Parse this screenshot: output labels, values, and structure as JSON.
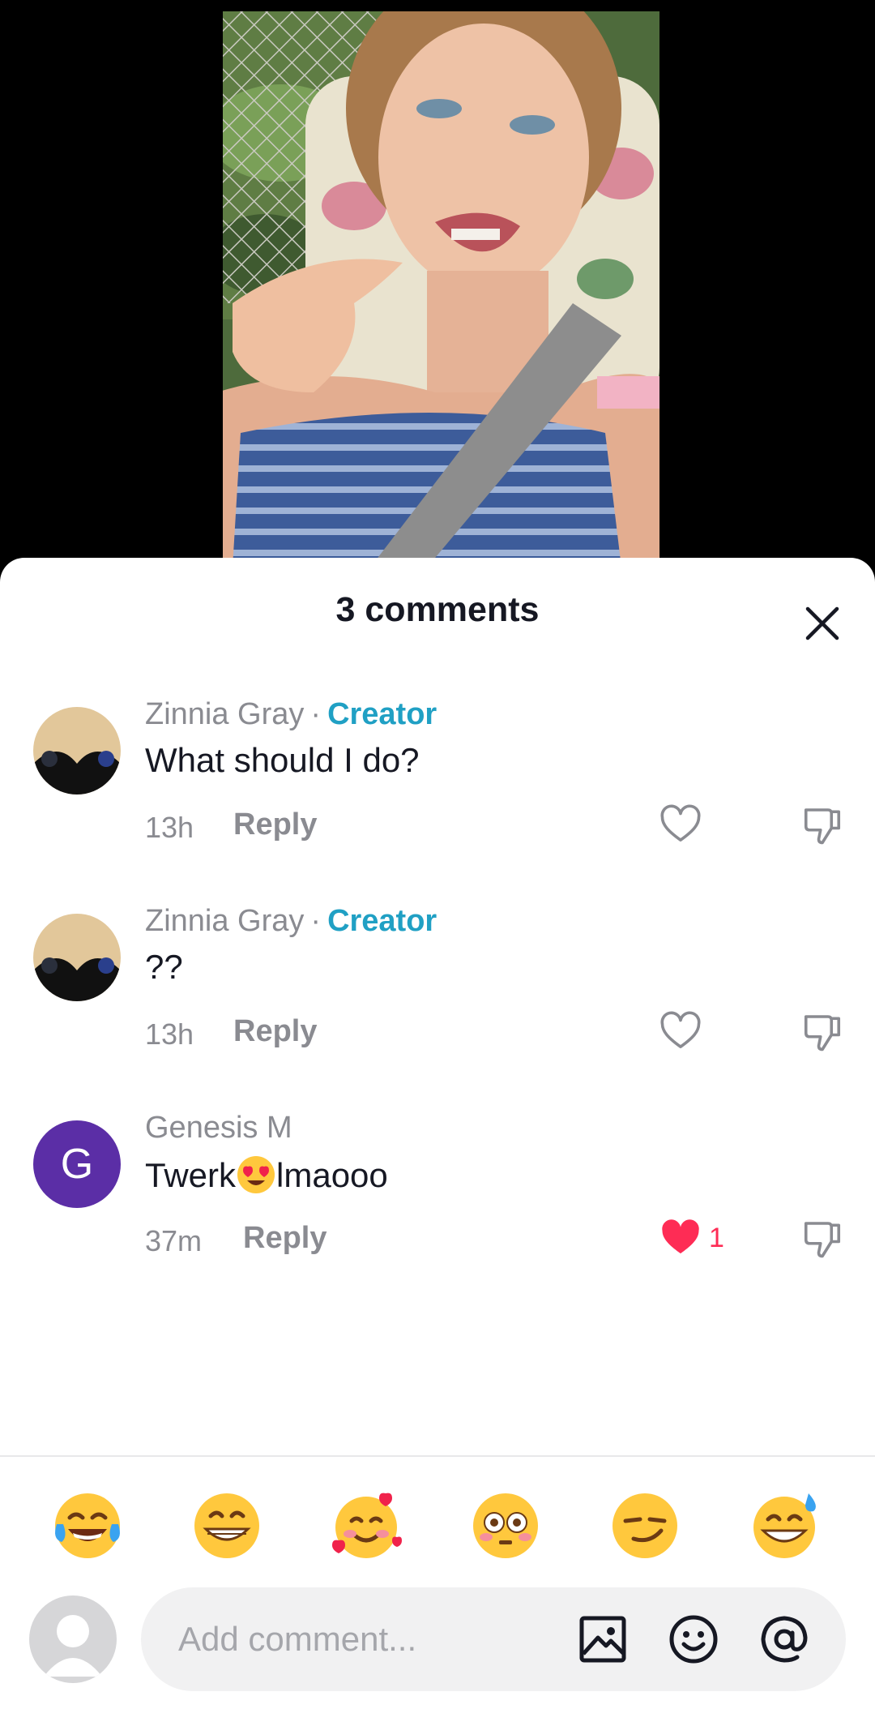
{
  "sheet": {
    "title": "3 comments"
  },
  "comments": [
    {
      "user": "Zinnia Gray",
      "separator": "·",
      "badge": "Creator",
      "text": "What should I do?",
      "time": "13h",
      "reply_label": "Reply",
      "liked": false,
      "like_count": ""
    },
    {
      "user": "Zinnia Gray",
      "separator": "·",
      "badge": "Creator",
      "text": "??",
      "time": "13h",
      "reply_label": "Reply",
      "liked": false,
      "like_count": ""
    },
    {
      "user": "Genesis M",
      "avatar_letter": "G",
      "text_before": "Twerk",
      "text_emoji": "heart-eyes-emoji",
      "text_after": "lmaooo",
      "time": "37m",
      "reply_label": "Reply",
      "liked": true,
      "like_count": "1"
    }
  ],
  "quick_emojis": [
    "tears-of-joy",
    "grinning",
    "smiling-with-hearts",
    "flushed",
    "smirk",
    "grinning-sweat"
  ],
  "input": {
    "placeholder": "Add comment..."
  },
  "colors": {
    "creator_badge": "#20a0c4",
    "like_active": "#fe2c55",
    "muted_text": "#8a8b91",
    "avatar_g": "#5b2ea6"
  }
}
